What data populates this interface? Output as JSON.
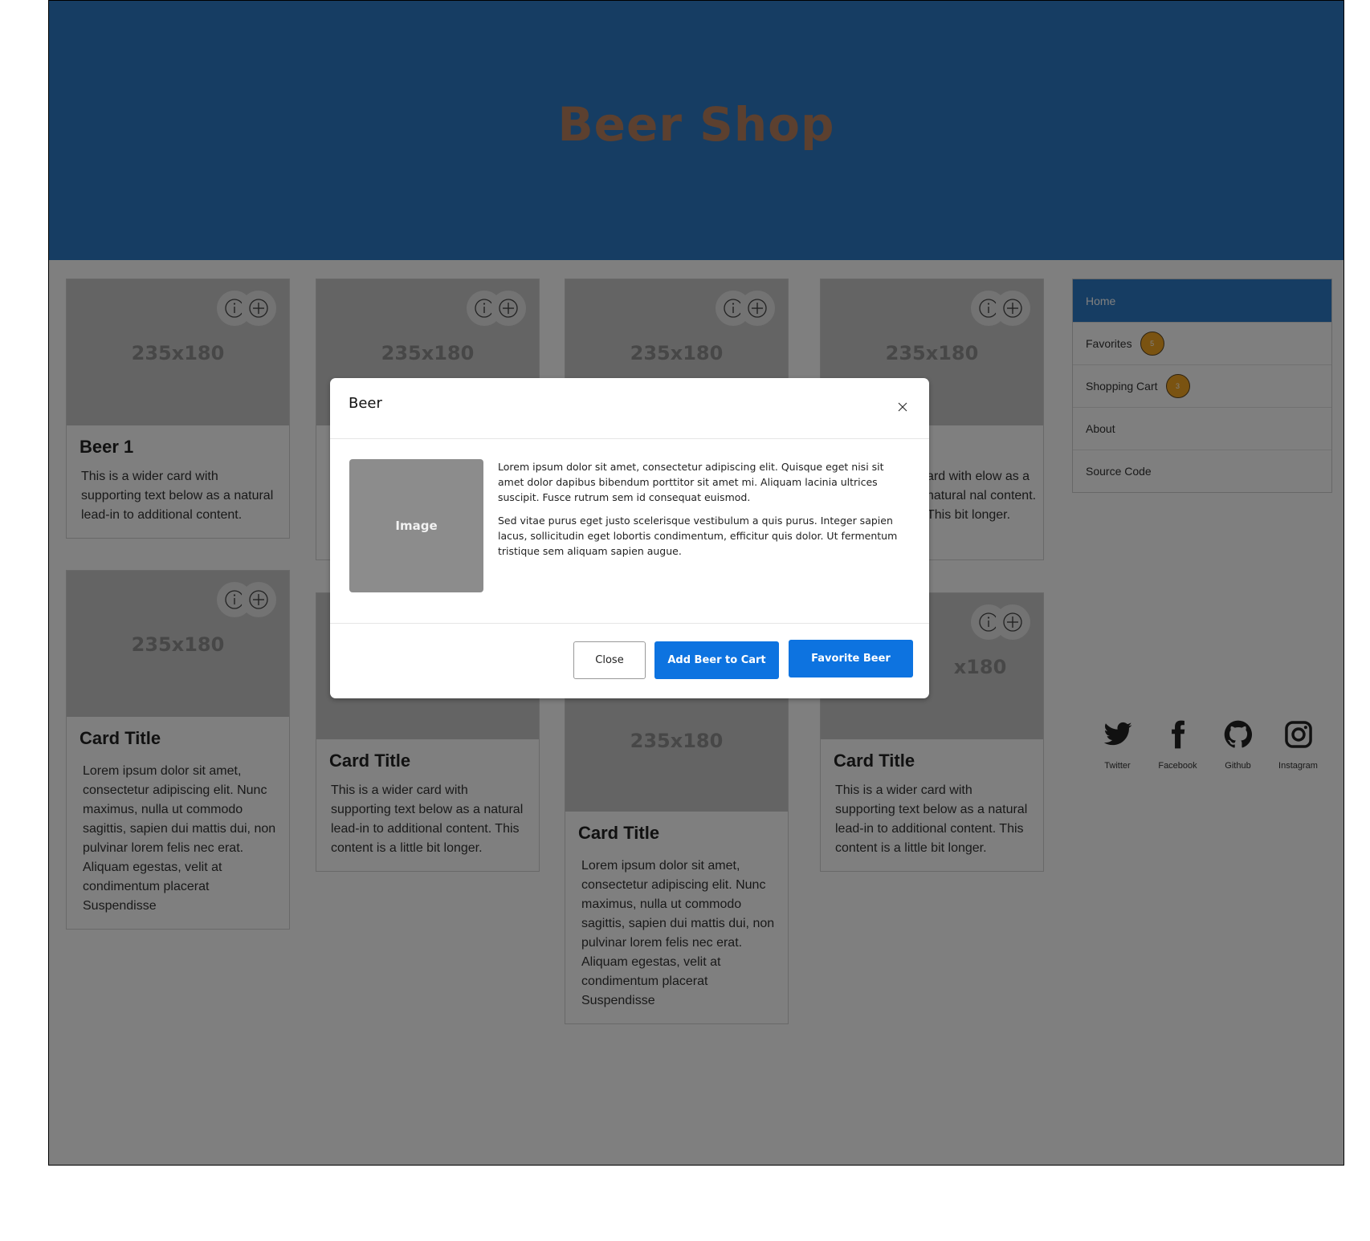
{
  "header": {
    "title": "Beer Shop"
  },
  "cards": [
    {
      "placeholder": "235x180",
      "title": "Beer 1",
      "text": "This is a wider card with supporting text below as a natural lead-in to additional content."
    },
    {
      "placeholder": "235x180",
      "title": "",
      "text": ""
    },
    {
      "placeholder": "235x180",
      "title": "",
      "text": ""
    },
    {
      "placeholder": "235x180",
      "title": "",
      "text": "ard with elow as a natural nal content. This bit longer."
    },
    {
      "placeholder": "235x180",
      "title": "Card Title",
      "text": "Lorem ipsum dolor sit amet, consectetur adipiscing elit. Nunc maximus, nulla ut commodo sagittis, sapien dui mattis dui, non pulvinar lorem felis nec erat. Aliquam egestas, velit at condimentum placerat Suspendisse"
    },
    {
      "placeholder": "235x180",
      "title": "Card Title",
      "text": "This is a wider card with supporting text below as a natural lead-in to additional content. This content is a little bit longer."
    },
    {
      "placeholder": "235x180",
      "title": "Card Title",
      "text": "Lorem ipsum dolor sit amet, consectetur adipiscing elit. Nunc maximus, nulla ut commodo sagittis, sapien dui mattis dui, non pulvinar lorem felis nec erat. Aliquam egestas, velit at condimentum placerat Suspendisse"
    },
    {
      "placeholder": "x180",
      "title": "Card Title",
      "text": "This is a wider card with supporting text below as a natural lead-in to additional content. This content is a little bit longer."
    }
  ],
  "sidebar": {
    "items": [
      {
        "label": "Home",
        "active": true
      },
      {
        "label": "Favorites",
        "badge": "5"
      },
      {
        "label": "Shopping Cart",
        "badge": "3"
      },
      {
        "label": "About"
      },
      {
        "label": "Source Code"
      }
    ]
  },
  "socials": [
    {
      "label": "Twitter",
      "icon": "twitter-icon"
    },
    {
      "label": "Facebook",
      "icon": "facebook-icon"
    },
    {
      "label": "Github",
      "icon": "github-icon"
    },
    {
      "label": "Instagram",
      "icon": "instagram-icon"
    }
  ],
  "modal": {
    "title": "Beer",
    "image_label": "Image",
    "paragraph1": "Lorem ipsum dolor sit amet, consectetur adipiscing elit. Quisque eget nisi sit amet dolor dapibus bibendum porttitor sit amet mi. Aliquam lacinia ultrices suscipit. Fusce rutrum sem id consequat euismod.",
    "paragraph2": "Sed vitae purus eget justo scelerisque vestibulum a quis purus. Integer sapien lacus, sollicitudin eget lobortis condimentum, efficitur quis dolor. Ut fermentum tristique sem aliquam sapien augue.",
    "close_label": "Close",
    "cart_label": "Add Beer to Cart",
    "favorite_label": "Favorite Beer"
  },
  "colors": {
    "header": "#2c7bc7",
    "button": "#0d73e0",
    "badge": "#f5a623",
    "title": "#b9805f"
  }
}
